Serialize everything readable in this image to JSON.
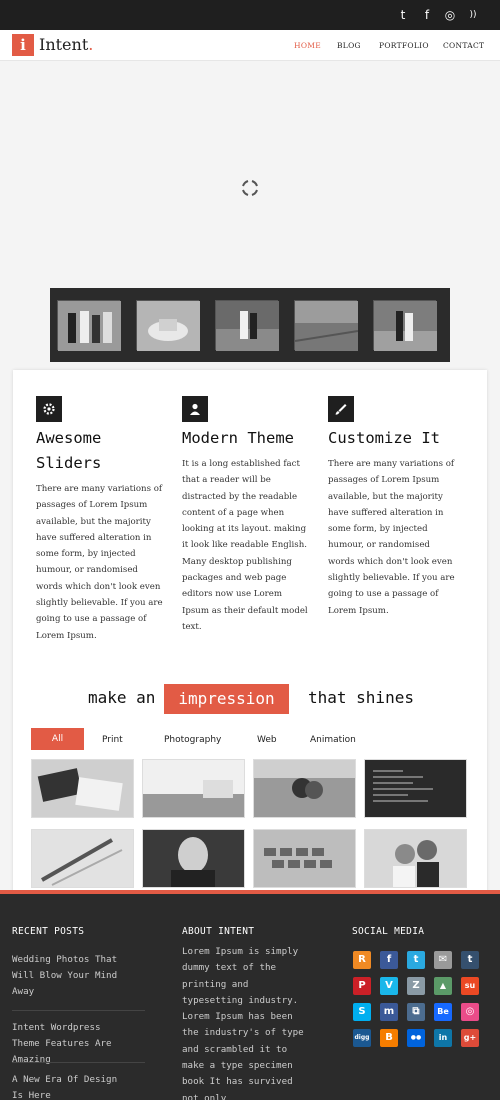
{
  "topbar": {
    "icons": [
      {
        "name": "twitter-icon",
        "glyph": "t"
      },
      {
        "name": "facebook-icon",
        "glyph": "f"
      },
      {
        "name": "dribbble-icon",
        "glyph": "◎"
      },
      {
        "name": "rss-icon",
        "glyph": "))"
      }
    ]
  },
  "brand": {
    "logo_letter": "i",
    "name": "Intent",
    "dot": ".",
    "accent": "#e25b45"
  },
  "nav": [
    {
      "label": "HOME",
      "active": true
    },
    {
      "label": "BLOG",
      "active": false
    },
    {
      "label": "PORTFOLIO",
      "active": false
    },
    {
      "label": "CONTACT",
      "active": false
    }
  ],
  "slider": {
    "loading_icon": "spinner-icon",
    "thumbnails": [
      "wedding-group",
      "wedding-cake",
      "bride-groom-hall",
      "beach-pier",
      "couple-walking"
    ]
  },
  "features": [
    {
      "icon": "gear-icon",
      "title": "Awesome Sliders",
      "body": "There are many variations of passages of Lorem Ipsum available, but the majority have suffered alteration in some form, by injected humour, or randomised words which don't look even slightly believable. If you are going to use a passage of Lorem Ipsum."
    },
    {
      "icon": "user-icon",
      "title": "Modern Theme",
      "body": "It is a long established fact that a reader will be distracted by the readable content of a page when looking at its layout. making it look like readable English. Many desktop publishing packages and web page editors now use Lorem Ipsum as their default model text."
    },
    {
      "icon": "brush-icon",
      "title": "Customize It",
      "body": "There are many variations of passages of Lorem Ipsum available, but the majority have suffered alteration in some form, by injected humour, or randomised words which don't look even slightly believable. If you are going to use a passage of Lorem Ipsum."
    }
  ],
  "tagline": {
    "before": "make an",
    "highlight": "impression",
    "after": "that shines"
  },
  "portfolio": {
    "filters": [
      {
        "label": "All",
        "active": true
      },
      {
        "label": "Print",
        "active": false
      },
      {
        "label": "Photography",
        "active": false
      },
      {
        "label": "Web",
        "active": false
      },
      {
        "label": "Animation",
        "active": false
      }
    ],
    "items": [
      "business-cards",
      "office-desk",
      "couple-embrace",
      "code-screen",
      "pen-closeup",
      "portrait-man",
      "keyboard",
      "wedding-couple"
    ]
  },
  "footer": {
    "recent_posts_heading": "RECENT POSTS",
    "recent_posts": [
      "Wedding Photos That Will Blow Your Mind Away",
      "Intent Wordpress Theme Features Are Amazing",
      "A New Era Of Design Is Here"
    ],
    "about_heading": "ABOUT INTENT",
    "about_text": "Lorem Ipsum is simply dummy text of the printing and typesetting industry. Lorem Ipsum has been the industry's of type and scrambled it to make a type specimen book It has survived not only",
    "social_heading": "SOCIAL MEDIA",
    "social_icons": [
      {
        "name": "rss-icon",
        "glyph": "R",
        "color": "#f08a24"
      },
      {
        "name": "facebook-icon",
        "glyph": "f",
        "color": "#3b5998"
      },
      {
        "name": "twitter-icon",
        "glyph": "t",
        "color": "#2aa9e0"
      },
      {
        "name": "email-icon",
        "glyph": "✉",
        "color": "#9a9a9a"
      },
      {
        "name": "tumblr-icon",
        "glyph": "t",
        "color": "#35506e"
      },
      {
        "name": "pinterest-icon",
        "glyph": "P",
        "color": "#cb2027"
      },
      {
        "name": "vimeo-icon",
        "glyph": "V",
        "color": "#1ab7ea"
      },
      {
        "name": "zerply-icon",
        "glyph": "Z",
        "color": "#8a9aa5"
      },
      {
        "name": "forrst-icon",
        "glyph": "▲",
        "color": "#5b9a68"
      },
      {
        "name": "stumbleupon-icon",
        "glyph": "su",
        "color": "#eb4924"
      },
      {
        "name": "skype-icon",
        "glyph": "S",
        "color": "#00aff0"
      },
      {
        "name": "myspace-icon",
        "glyph": "m",
        "color": "#3b5998"
      },
      {
        "name": "share-icon",
        "glyph": "⧉",
        "color": "#4c6c8f"
      },
      {
        "name": "behance-icon",
        "glyph": "Be",
        "color": "#1769ff"
      },
      {
        "name": "dribbble-icon",
        "glyph": "◎",
        "color": "#ea4c89"
      },
      {
        "name": "digg-icon",
        "glyph": "digg",
        "color": "#1b5891"
      },
      {
        "name": "blogger-icon",
        "glyph": "B",
        "color": "#f57d00"
      },
      {
        "name": "flickr-icon",
        "glyph": "●●",
        "color": "#0063dc"
      },
      {
        "name": "linkedin-icon",
        "glyph": "in",
        "color": "#0e76a8"
      },
      {
        "name": "googleplus-icon",
        "glyph": "g+",
        "color": "#dd4b39"
      }
    ]
  }
}
